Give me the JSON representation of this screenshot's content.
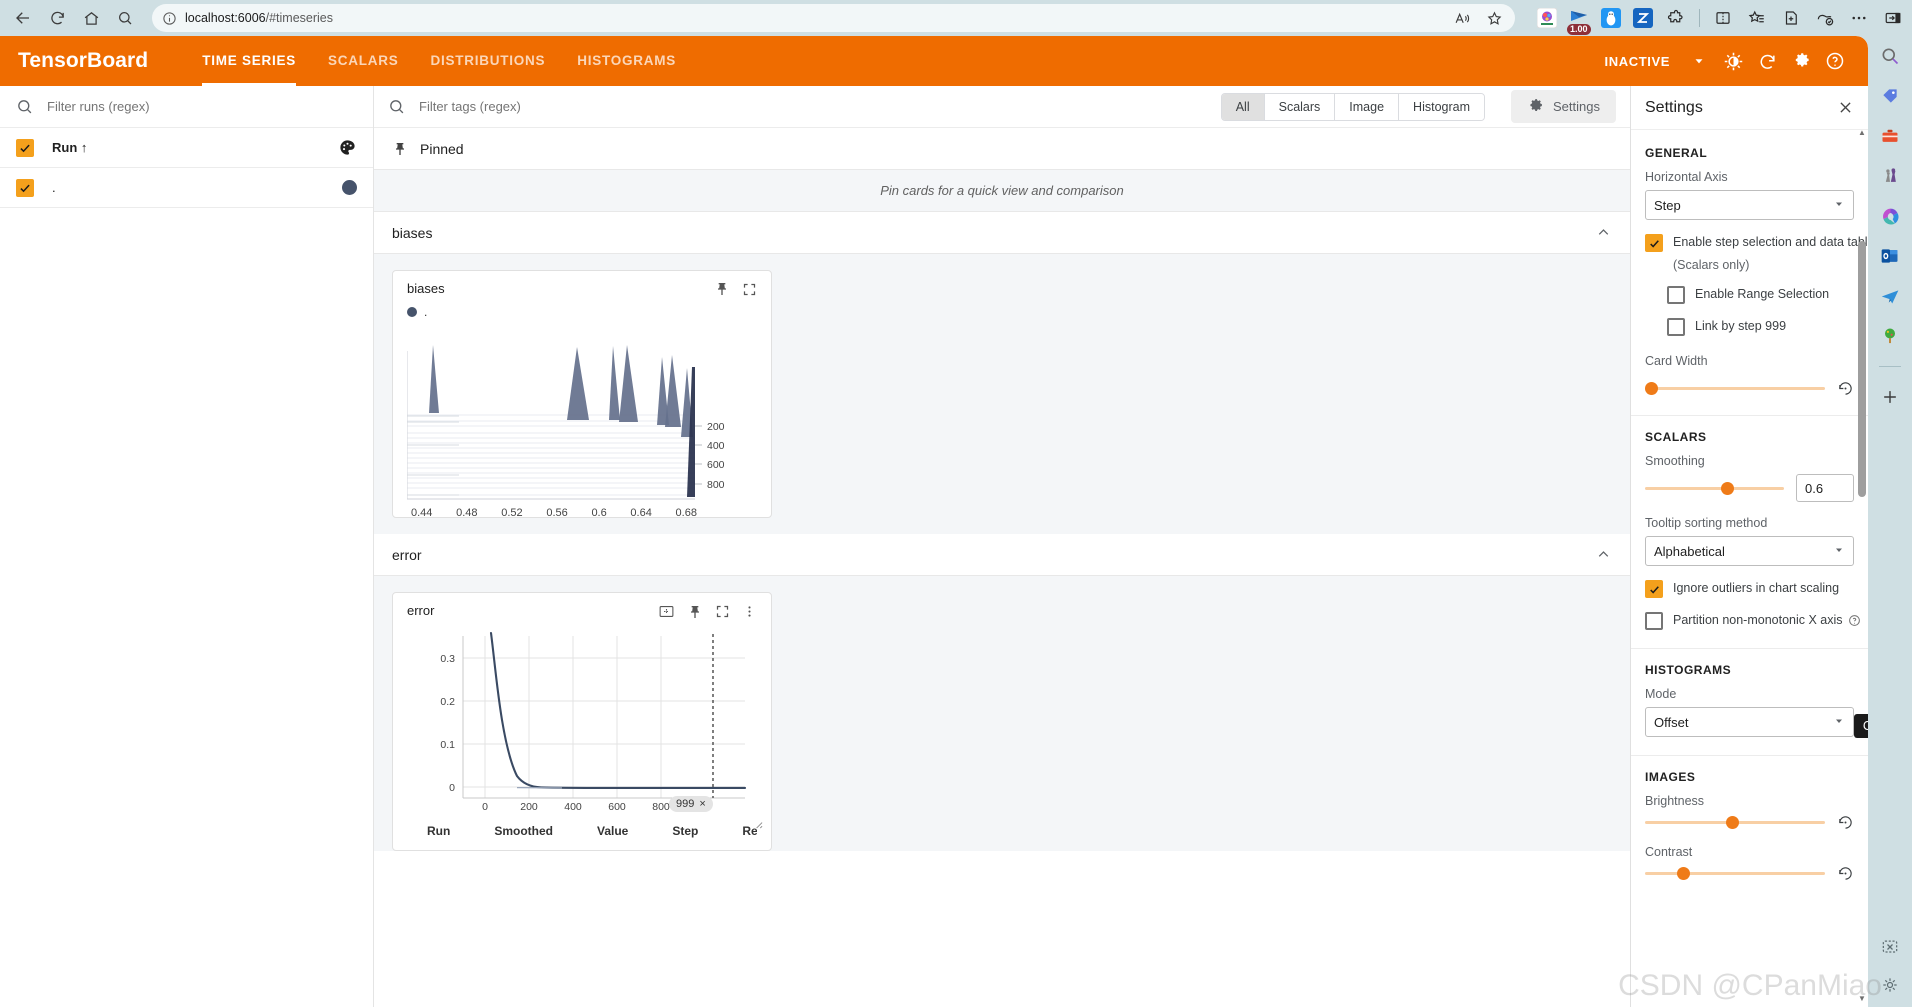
{
  "browser": {
    "url_host": "localhost:6006",
    "url_path": "/#timeseries",
    "nav": {
      "back": "back-arrow",
      "reload": "reload",
      "home": "home",
      "search": "search"
    },
    "read_aloud": "read-aloud-icon",
    "favorite": "favorite-star-icon",
    "extension_badge": "1.00",
    "icons": [
      "collections-icon",
      "split-screen-icon",
      "favorites-icon",
      "add-tab-icon",
      "copilot-icon",
      "more-icon",
      "sidebar-toggle-icon"
    ]
  },
  "rail": {
    "items": [
      "search-icon",
      "tag-icon",
      "toolbox-icon",
      "games-icon",
      "copilot-icon",
      "outlook-icon",
      "telegram-icon",
      "tree-icon",
      "add-icon",
      "tools-icon",
      "settings-icon"
    ]
  },
  "header": {
    "logo": "TensorBoard",
    "tabs": [
      {
        "label": "TIME SERIES",
        "active": true
      },
      {
        "label": "SCALARS",
        "active": false
      },
      {
        "label": "DISTRIBUTIONS",
        "active": false
      },
      {
        "label": "HISTOGRAMS",
        "active": false
      }
    ],
    "status": "INACTIVE",
    "actions": [
      "dropdown-caret-icon",
      "brightness-icon",
      "reload-icon",
      "settings-gear-icon",
      "help-icon"
    ]
  },
  "runs_pane": {
    "filter_placeholder": "Filter runs (regex)",
    "filter_value": "",
    "column_header": "Run",
    "sort_arrow": "↑",
    "palette_icon": "color-palette-icon",
    "runs": [
      {
        "name": ".",
        "checked": true,
        "color": "#46536b"
      }
    ]
  },
  "tags_bar": {
    "filter_placeholder": "Filter tags (regex)",
    "filter_value": "",
    "toggles": [
      {
        "label": "All",
        "selected": true
      },
      {
        "label": "Scalars",
        "selected": false
      },
      {
        "label": "Image",
        "selected": false
      },
      {
        "label": "Histogram",
        "selected": false
      }
    ],
    "settings_label": "Settings"
  },
  "pinned": {
    "title": "Pinned",
    "empty_text": "Pin cards for a quick view and comparison"
  },
  "sections": [
    {
      "title": "biases",
      "collapse_icon": "chevron-up-icon"
    },
    {
      "title": "error",
      "collapse_icon": "chevron-up-icon"
    }
  ],
  "cards": [
    {
      "title": "biases",
      "run_legend": ".",
      "actions": [
        "pin-icon",
        "fullscreen-icon"
      ]
    },
    {
      "title": "error",
      "actions": [
        "fit-domain-icon",
        "pin-icon",
        "fullscreen-icon",
        "more-vert-icon"
      ],
      "step_chip": "999",
      "step_chip_close": "×",
      "table_headers": [
        "Run",
        "Smoothed",
        "Value",
        "Step",
        "Relative"
      ]
    }
  ],
  "chart_data": [
    {
      "type": "area",
      "name": "biases-histogram-offset",
      "title": "biases",
      "mode": "Offset",
      "xlabel": "",
      "ylabel": "",
      "xlim": [
        0.42,
        0.7
      ],
      "xticks": [
        "0.44",
        "0.48",
        "0.52",
        "0.56",
        "0.6",
        "0.64",
        "0.68"
      ],
      "step_axis_labels": [
        "200",
        "400",
        "600",
        "800"
      ],
      "ridges": [
        {
          "step": 0,
          "center": 0.444,
          "height": 0.88,
          "width": 0.009
        },
        {
          "step": 100,
          "center": 0.572,
          "height": 0.84,
          "width": 0.012
        },
        {
          "step": 200,
          "center": 0.608,
          "height": 0.88,
          "width": 0.008
        },
        {
          "step": 300,
          "center": 0.622,
          "height": 0.88,
          "width": 0.011
        },
        {
          "step": 400,
          "center": 0.664,
          "height": 0.8,
          "width": 0.01
        },
        {
          "step": 500,
          "center": 0.674,
          "height": 0.82,
          "width": 0.01
        },
        {
          "step": 600,
          "center": 0.687,
          "height": 0.7,
          "width": 0.009
        },
        {
          "step": 999,
          "center": 0.694,
          "height": 0.98,
          "width": 0.005
        }
      ],
      "series_color": "#64708c"
    },
    {
      "type": "line",
      "name": "error-scalar",
      "title": "error",
      "xlabel": "",
      "ylabel": "",
      "xlim": [
        -60,
        1060
      ],
      "ylim": [
        -0.05,
        0.36
      ],
      "xticks": [
        0,
        200,
        400,
        600,
        800
      ],
      "yticks": [
        0,
        0.1,
        0.2,
        0.3
      ],
      "selected_step": 999,
      "grid": true,
      "series": [
        {
          "name": ".",
          "color": "#3a4a63",
          "x": [
            30,
            45,
            60,
            75,
            90,
            105,
            120,
            140,
            160,
            180,
            200,
            230,
            260,
            300,
            360,
            420,
            500,
            600,
            700,
            800,
            900,
            999
          ],
          "y": [
            0.4,
            0.33,
            0.25,
            0.175,
            0.12,
            0.082,
            0.057,
            0.035,
            0.022,
            0.014,
            0.009,
            0.005,
            0.003,
            0.002,
            0.0015,
            0.001,
            0.001,
            0.0008,
            0.0006,
            0.0005,
            0.0004,
            0.0003
          ]
        }
      ]
    }
  ],
  "settings": {
    "title": "Settings",
    "close_icon": "close-icon",
    "general": {
      "group": "GENERAL",
      "horizontal_axis_label": "Horizontal Axis",
      "horizontal_axis_value": "Step",
      "enable_step_selection": {
        "label": "Enable step selection and data table",
        "checked": true
      },
      "scalars_only_note": "(Scalars only)",
      "enable_range_selection": {
        "label": "Enable Range Selection",
        "checked": false
      },
      "link_by_step": {
        "label": "Link by step 999",
        "checked": false
      },
      "card_width_label": "Card Width",
      "card_width_pct": 0,
      "reset_icon": "reset-icon"
    },
    "scalars": {
      "group": "SCALARS",
      "smoothing_label": "Smoothing",
      "smoothing_value": "0.6",
      "smoothing_pct": 60,
      "tooltip_sort_label": "Tooltip sorting method",
      "tooltip_sort_value": "Alphabetical",
      "ignore_outliers": {
        "label": "Ignore outliers in chart scaling",
        "checked": true
      },
      "partition_x": {
        "label": "Partition non-monotonic X axis",
        "checked": false,
        "help_icon": "help-icon"
      }
    },
    "histograms": {
      "group": "HISTOGRAMS",
      "mode_label": "Mode",
      "mode_value": "Offset"
    },
    "images": {
      "group": "IMAGES",
      "brightness_label": "Brightness",
      "brightness_pct": 50,
      "contrast_label": "Contrast",
      "contrast_pct": 22
    }
  },
  "overlays": {
    "tooltip": "ChatGPT",
    "watermark": "CSDN @CPanMiao"
  },
  "colors": {
    "brand_orange": "#ef6c00",
    "accent_orange": "#f4a01c",
    "slider_orange": "#e8650d",
    "series_navy": "#46536b",
    "browser_chrome": "#cfdfe3"
  }
}
